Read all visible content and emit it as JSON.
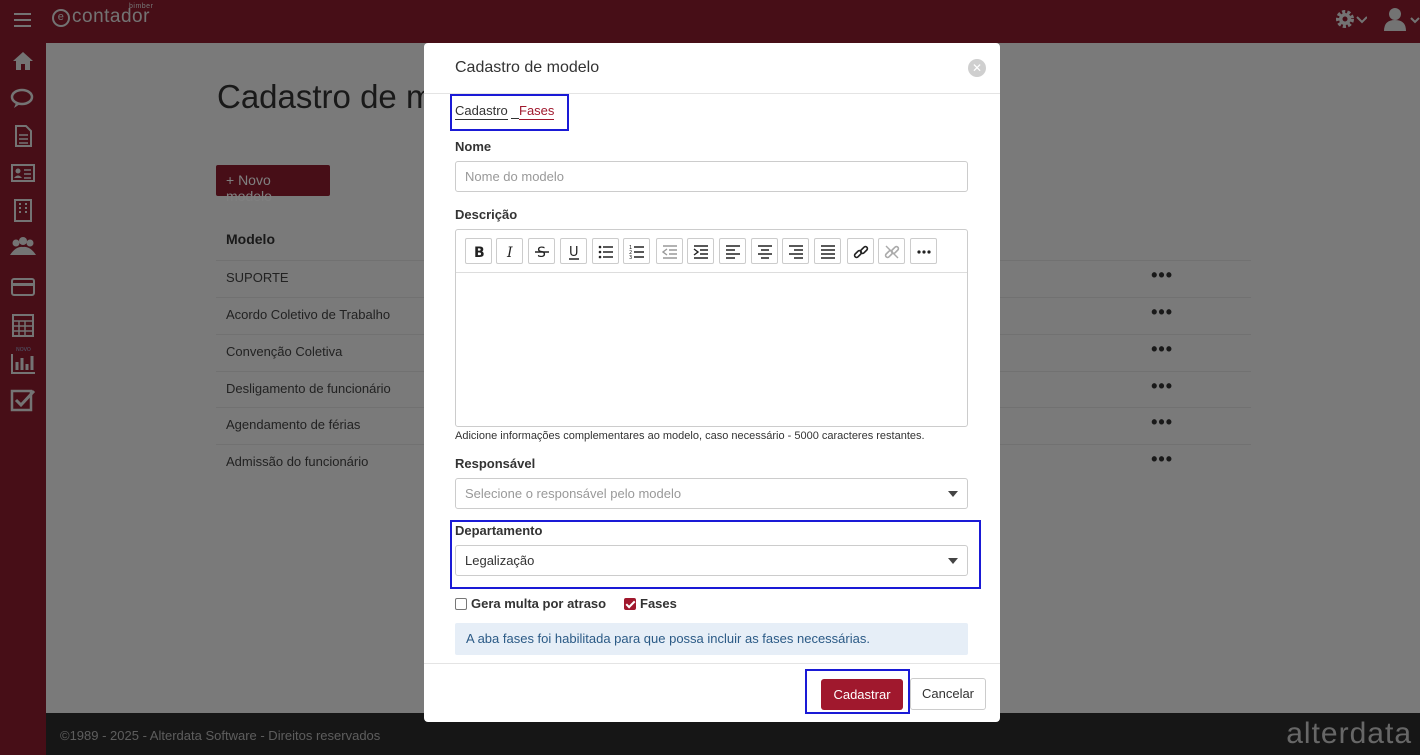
{
  "app": {
    "logo_text": "contador",
    "logo_super": "bimber",
    "icons": {
      "menu": "hamburger-icon",
      "settings": "gear-icon",
      "user": "user-icon"
    },
    "sidebar": [
      {
        "icon": "home-icon"
      },
      {
        "icon": "chat-icon"
      },
      {
        "icon": "document-icon"
      },
      {
        "icon": "id-card-icon"
      },
      {
        "icon": "building-icon"
      },
      {
        "icon": "users-icon"
      },
      {
        "icon": "card-icon"
      },
      {
        "icon": "calculator-icon"
      },
      {
        "icon": "chart-icon",
        "badge": "NOVO"
      },
      {
        "icon": "checkbox-icon"
      }
    ]
  },
  "page": {
    "title": "Cadastro de modelos",
    "new_button": "+ Novo modelo",
    "column_header": "Modelo",
    "rows": [
      "SUPORTE",
      "Acordo Coletivo de Trabalho",
      "Convenção Coletiva",
      "Desligamento de funcionário",
      "Agendamento de férias",
      "Admissão do funcionário"
    ],
    "row_action": "•••"
  },
  "footer": {
    "copyright": "©1989 - 2025 - Alterdata Software - Direitos reservados",
    "brand": "alterdata"
  },
  "modal": {
    "title": "Cadastro de modelo",
    "close_icon": "close-icon",
    "tabs": [
      "Cadastro",
      "Fases"
    ],
    "nome_label": "Nome",
    "nome_placeholder": "Nome do modelo",
    "descricao_label": "Descrição",
    "toolbar": [
      "bold-icon",
      "italic-icon",
      "strikethrough-icon",
      "underline-icon",
      "bullet-list-icon",
      "numbered-list-icon",
      "outdent-icon",
      "indent-icon",
      "align-left-icon",
      "align-center-icon",
      "align-right-icon",
      "align-justify-icon",
      "link-icon",
      "unlink-icon",
      "more-icon"
    ],
    "descricao_hint": "Adicione informações complementares ao modelo, caso necessário - 5000 caracteres restantes.",
    "responsavel_label": "Responsável",
    "responsavel_placeholder": "Selecione o responsável pelo modelo",
    "departamento_label": "Departamento",
    "departamento_value": "Legalização",
    "gera_multa_label": "Gera multa por atraso",
    "gera_multa_checked": false,
    "fases_label": "Fases",
    "fases_checked": true,
    "info_text": "A aba fases foi habilitada para que possa incluir as fases necessárias.",
    "submit_label": "Cadastrar",
    "cancel_label": "Cancelar"
  },
  "colors": {
    "brand": "#8e1d2f",
    "accent": "#a0182d",
    "highlight": "#1a1ad6",
    "info_bg": "#e6eef7"
  }
}
